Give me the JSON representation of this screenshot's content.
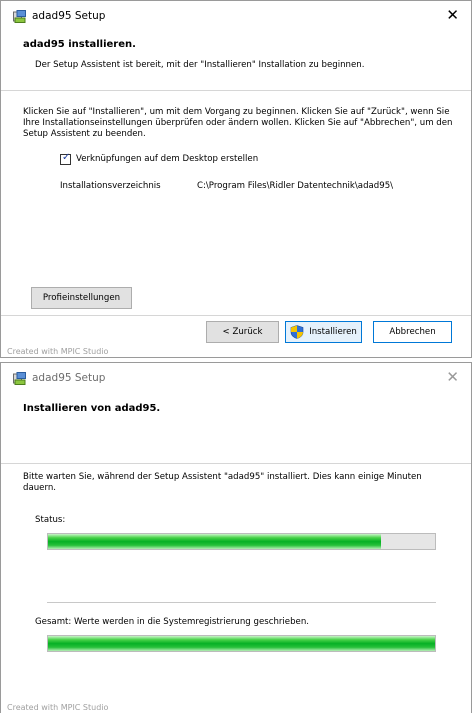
{
  "window1": {
    "title": "adad95 Setup",
    "header": {
      "title": "adad95 installieren.",
      "description": "Der Setup Assistent ist bereit, mit der \"Installieren\" Installation zu beginnen."
    },
    "instructions": "Klicken Sie auf \"Installieren\", um mit dem Vorgang zu beginnen. Klicken Sie auf \"Zurück\", wenn Sie Ihre Installationseinstellungen überprüfen oder ändern wollen. Klicken Sie auf \"Abbrechen\", um den Setup Assistent zu beenden.",
    "checkbox": {
      "label": "Verknüpfungen auf dem Desktop erstellen",
      "checked": true
    },
    "install_dir": {
      "label": "Installationsverzeichnis",
      "value": "C:\\Program Files\\Ridler Datentechnik\\adad95\\"
    },
    "buttons": {
      "profile": "Profieinstellungen",
      "back": "< Zurück",
      "install": "Installieren",
      "cancel": "Abbrechen"
    },
    "footer": "Created with MPIC Studio"
  },
  "window2": {
    "title": "adad95 Setup",
    "header": {
      "title": "Installieren von adad95."
    },
    "message": "Bitte warten Sie, während der Setup Assistent \"adad95\" installiert. Dies kann einige Minuten dauern.",
    "status_label": "Status:",
    "status_progress": 0.86,
    "total_label": "Gesamt:  Werte werden in die Systemregistrierung geschrieben.",
    "total_progress": 1.0,
    "footer": "Created with MPIC Studio"
  }
}
